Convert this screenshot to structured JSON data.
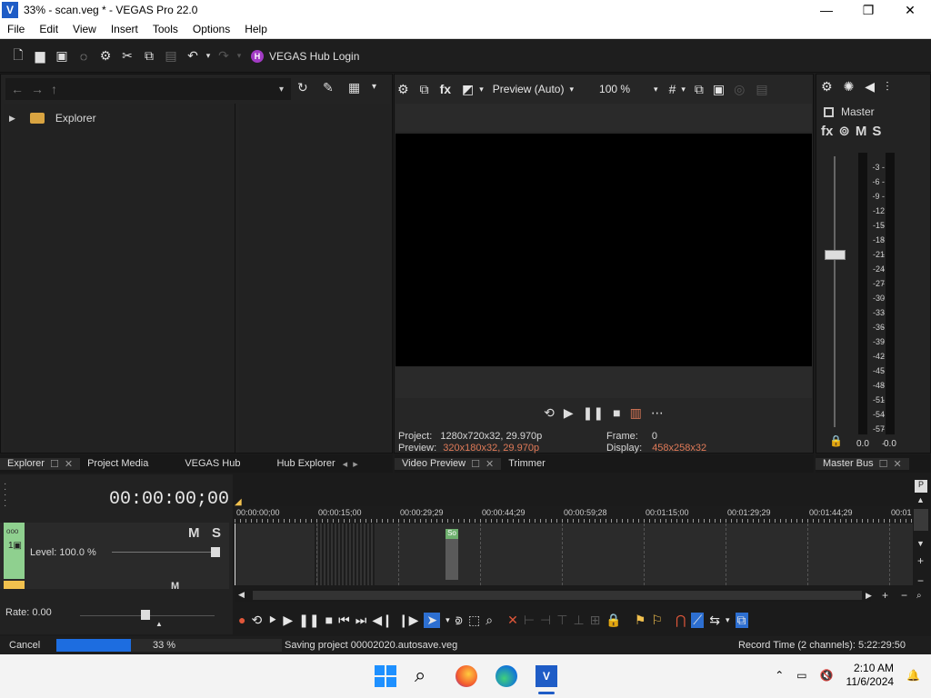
{
  "window": {
    "title": "33% - scan.veg * - VEGAS Pro 22.0",
    "badge": "V",
    "controls": [
      "—",
      "❐",
      "✕"
    ]
  },
  "menu": [
    "File",
    "Edit",
    "View",
    "Insert",
    "Tools",
    "Options",
    "Help"
  ],
  "toolbar": {
    "hub_badge": "H",
    "hub_login": "VEGAS Hub Login",
    "icons": [
      "new-file-icon",
      "open-folder-icon",
      "save-icon",
      "properties-icon",
      "settings-gear-icon",
      "cut-icon",
      "copy-icon",
      "paste-icon",
      "undo-icon",
      "redo-icon"
    ]
  },
  "explorer": {
    "root": "Explorer"
  },
  "preview": {
    "mode": "Preview (Auto)",
    "zoom": "100 %",
    "project_label": "Project:",
    "project_value": "1280x720x32, 29.970p",
    "preview_label": "Preview:",
    "preview_value": "320x180x32, 29.970p",
    "frame_label": "Frame:",
    "frame_value": "0",
    "display_label": "Display:",
    "display_value": "458x258x32"
  },
  "master": {
    "label": "Master",
    "fx": "fx",
    "m": "M",
    "s": "S",
    "scale": [
      "3",
      "6",
      "9",
      "12",
      "15",
      "18",
      "21",
      "24",
      "27",
      "30",
      "33",
      "36",
      "39",
      "42",
      "45",
      "48",
      "51",
      "54",
      "57"
    ],
    "left_peak": "0.0",
    "right_peak": "0.0"
  },
  "tabs": {
    "left": [
      "Explorer",
      "Project Media",
      "VEGAS Hub",
      "Hub Explorer"
    ],
    "middle": [
      "Video Preview",
      "Trimmer"
    ],
    "right": "Master Bus"
  },
  "timeline": {
    "timecode": "00:00:00;00",
    "track_m": "M",
    "track_s": "S",
    "level": "Level: 100.0 %",
    "rate": "Rate: 0.00",
    "ruler": [
      "00:00:00;00",
      "00:00:15;00",
      "00:00:29;29",
      "00:00:44;29",
      "00:00:59;28",
      "00:01:15;00",
      "00:01:29;29",
      "00:01:44;29",
      "00:01"
    ]
  },
  "status": {
    "cancel": "Cancel",
    "progress_percent": 33,
    "progress_text": "33 %",
    "message": "Saving project 00002020.autosave.veg",
    "record_time": "Record Time (2 channels): 5:22:29:50"
  },
  "taskbar": {
    "time": "2:10 AM",
    "date": "11/6/2024"
  }
}
